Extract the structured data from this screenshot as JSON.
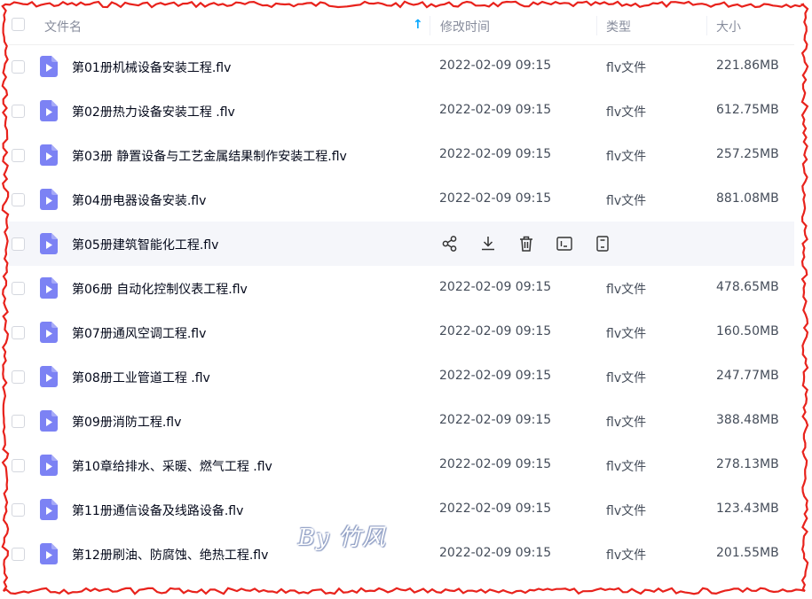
{
  "header": {
    "name_label": "文件名",
    "sort_arrow": "↑",
    "date_label": "修改时间",
    "type_label": "类型",
    "size_label": "大小"
  },
  "files": [
    {
      "name": "第01册机械设备安装工程.flv",
      "date": "2022-02-09 09:15",
      "type": "flv文件",
      "size": "221.86MB"
    },
    {
      "name": "第02册热力设备安装工程 .flv",
      "date": "2022-02-09 09:15",
      "type": "flv文件",
      "size": "612.75MB"
    },
    {
      "name": "第03册 静置设备与工艺金属结果制作安装工程.flv",
      "date": "2022-02-09 09:15",
      "type": "flv文件",
      "size": "257.25MB"
    },
    {
      "name": "第04册电器设备安装.flv",
      "date": "2022-02-09 09:15",
      "type": "flv文件",
      "size": "881.08MB"
    },
    {
      "name": "第05册建筑智能化工程.flv",
      "date": "",
      "type": "",
      "size": "",
      "hover": true
    },
    {
      "name": "第06册 自动化控制仪表工程.flv",
      "date": "2022-02-09 09:15",
      "type": "flv文件",
      "size": "478.65MB"
    },
    {
      "name": "第07册通风空调工程.flv",
      "date": "2022-02-09 09:15",
      "type": "flv文件",
      "size": "160.50MB"
    },
    {
      "name": "第08册工业管道工程 .flv",
      "date": "2022-02-09 09:15",
      "type": "flv文件",
      "size": "247.77MB"
    },
    {
      "name": "第09册消防工程.flv",
      "date": "2022-02-09 09:15",
      "type": "flv文件",
      "size": "388.48MB"
    },
    {
      "name": "第10章给排水、采暖、燃气工程 .flv",
      "date": "2022-02-09 09:15",
      "type": "flv文件",
      "size": "278.13MB"
    },
    {
      "name": "第11册通信设备及线路设备.flv",
      "date": "2022-02-09 09:15",
      "type": "flv文件",
      "size": "123.43MB"
    },
    {
      "name": "第12册刷油、防腐蚀、绝热工程.flv",
      "date": "2022-02-09 09:15",
      "type": "flv文件",
      "size": "201.55MB"
    }
  ],
  "hover_actions": [
    "share-icon",
    "download-icon",
    "delete-icon",
    "rename-icon",
    "more-icon"
  ],
  "watermark": "By 竹风",
  "colors": {
    "accent": "#06a7ff",
    "file_icon": "#7c82f4",
    "frame": "#e8221c"
  }
}
